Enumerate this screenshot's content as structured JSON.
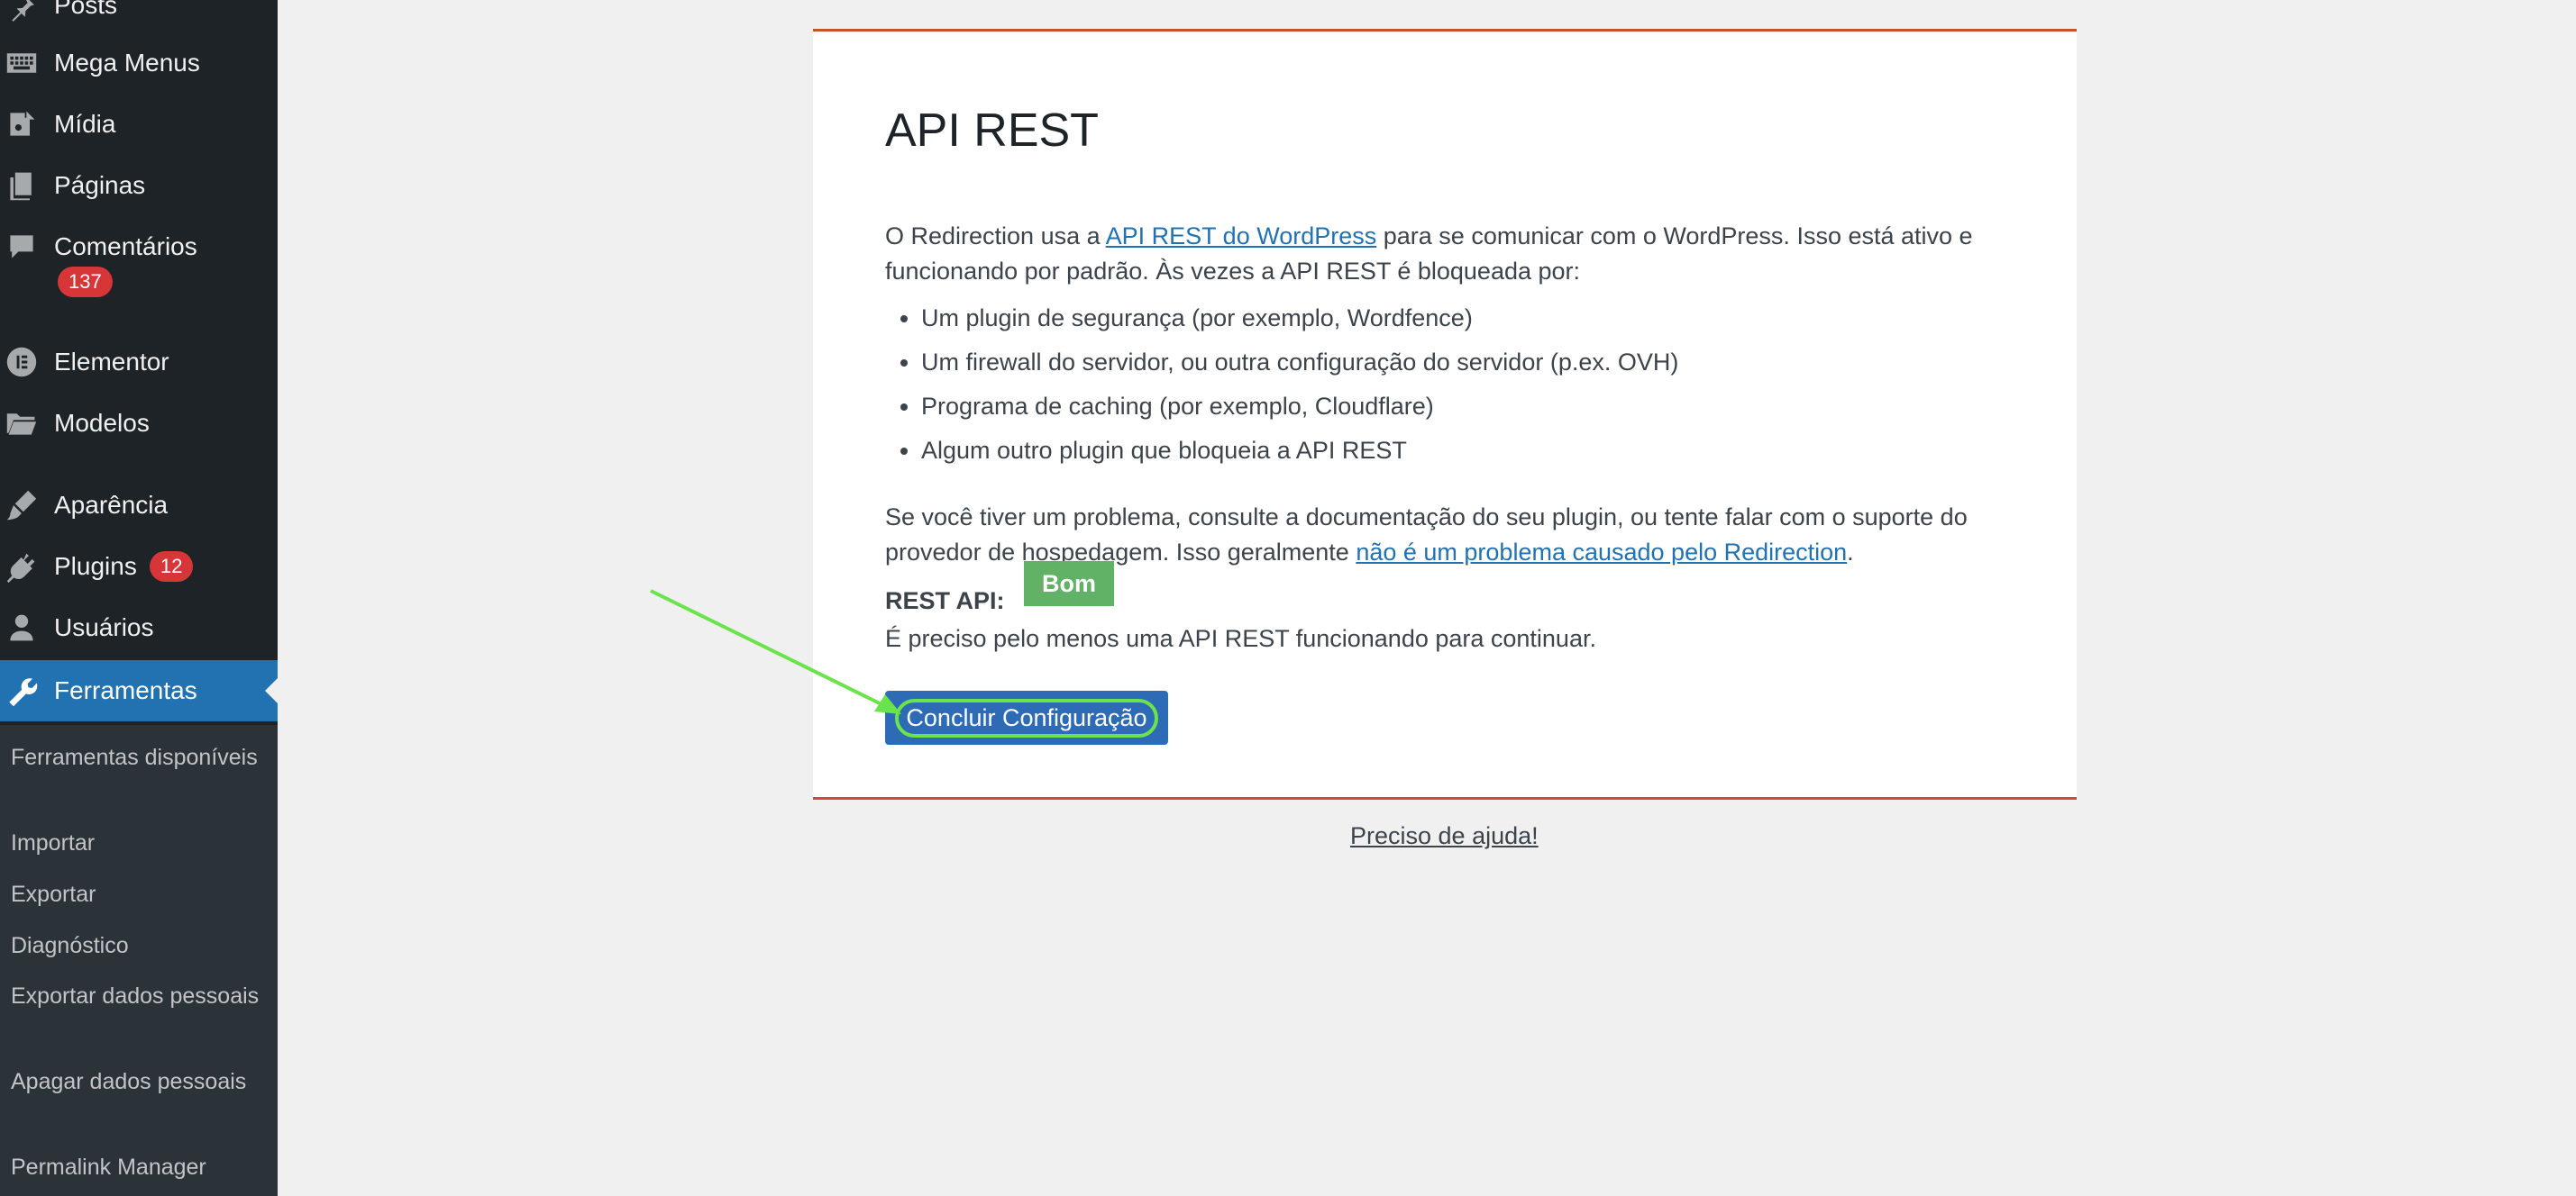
{
  "sidebar": {
    "items": [
      {
        "label": "Posts",
        "icon": "pin-icon"
      },
      {
        "label": "Mega Menus",
        "icon": "keyboard-icon"
      },
      {
        "label": "Mídia",
        "icon": "media-icon"
      },
      {
        "label": "Páginas",
        "icon": "pages-icon"
      },
      {
        "label": "Comentários",
        "icon": "comment-icon",
        "badge": "137"
      },
      {
        "label": "Elementor",
        "icon": "elementor-icon"
      },
      {
        "label": "Modelos",
        "icon": "folder-icon"
      },
      {
        "label": "Aparência",
        "icon": "brush-icon"
      },
      {
        "label": "Plugins",
        "icon": "plug-icon",
        "badge": "12"
      },
      {
        "label": "Usuários",
        "icon": "user-icon"
      },
      {
        "label": "Ferramentas",
        "icon": "wrench-icon",
        "active": true
      }
    ],
    "submenu": [
      "Ferramentas disponíveis",
      "Importar",
      "Exportar",
      "Diagnóstico",
      "Exportar dados pessoais",
      "Apagar dados pessoais",
      "Permalink Manager"
    ]
  },
  "card": {
    "title": "API REST",
    "intro_pre": "O Redirection usa a ",
    "intro_link": "API REST do WordPress",
    "intro_post": " para se comunicar com o WordPress. Isso está ativo e funcionando por padrão. Às vezes a API REST é bloqueada por:",
    "bullets": [
      "Um plugin de segurança (por exemplo, Wordfence)",
      "Um firewall do servidor, ou outra configuração do servidor (p.ex. OVH)",
      "Programa de caching (por exemplo, Cloudflare)",
      "Algum outro plugin que bloqueia a API REST"
    ],
    "problem_pre": "Se você tiver um problema, consulte a documentação do seu plugin, ou tente falar com o suporte do provedor de hospedagem. Isso geralmente ",
    "problem_link": "não é um problema causado pelo Redirection",
    "problem_post": ".",
    "rest_label": "REST API:",
    "rest_status": "Bom",
    "requirement": "É preciso pelo menos uma API REST funcionando para continuar.",
    "finish_button": "Concluir Configuração"
  },
  "help_link": "Preciso de ajuda!",
  "colors": {
    "sidebar_bg": "#1d2327",
    "submenu_bg": "#2c3338",
    "active_bg": "#2271b1",
    "badge_bg": "#d63638",
    "card_border": "#c9512d",
    "status_good": "#61b266",
    "button_bg": "#2e6bb6",
    "annotation_arrow": "#6be34b"
  }
}
